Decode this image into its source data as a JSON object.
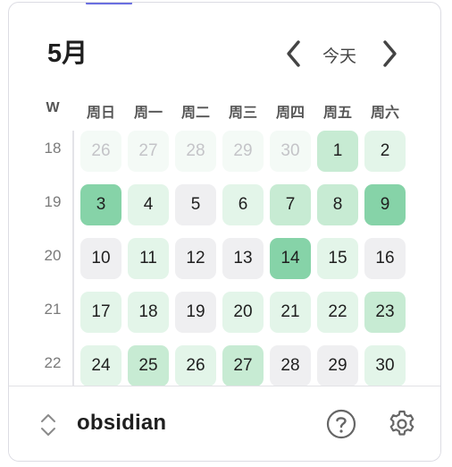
{
  "header": {
    "month_title": "5月",
    "today_label": "今天"
  },
  "weekday_header": {
    "week_col": "W",
    "days": [
      "周日",
      "周一",
      "周二",
      "周三",
      "周四",
      "周五",
      "周六"
    ]
  },
  "weeks": [
    {
      "week": "18",
      "days": [
        {
          "d": "26",
          "lvl": "out"
        },
        {
          "d": "27",
          "lvl": "out"
        },
        {
          "d": "28",
          "lvl": "out"
        },
        {
          "d": "29",
          "lvl": "out"
        },
        {
          "d": "30",
          "lvl": "out"
        },
        {
          "d": "1",
          "lvl": "2"
        },
        {
          "d": "2",
          "lvl": "1"
        }
      ]
    },
    {
      "week": "19",
      "days": [
        {
          "d": "3",
          "lvl": "3"
        },
        {
          "d": "4",
          "lvl": "1"
        },
        {
          "d": "5",
          "lvl": "0"
        },
        {
          "d": "6",
          "lvl": "1"
        },
        {
          "d": "7",
          "lvl": "2"
        },
        {
          "d": "8",
          "lvl": "2"
        },
        {
          "d": "9",
          "lvl": "3"
        }
      ]
    },
    {
      "week": "20",
      "days": [
        {
          "d": "10",
          "lvl": "0"
        },
        {
          "d": "11",
          "lvl": "1"
        },
        {
          "d": "12",
          "lvl": "0"
        },
        {
          "d": "13",
          "lvl": "0"
        },
        {
          "d": "14",
          "lvl": "3"
        },
        {
          "d": "15",
          "lvl": "1"
        },
        {
          "d": "16",
          "lvl": "0"
        }
      ]
    },
    {
      "week": "21",
      "days": [
        {
          "d": "17",
          "lvl": "1"
        },
        {
          "d": "18",
          "lvl": "1"
        },
        {
          "d": "19",
          "lvl": "0"
        },
        {
          "d": "20",
          "lvl": "1"
        },
        {
          "d": "21",
          "lvl": "1"
        },
        {
          "d": "22",
          "lvl": "1"
        },
        {
          "d": "23",
          "lvl": "2"
        }
      ]
    },
    {
      "week": "22",
      "days": [
        {
          "d": "24",
          "lvl": "1"
        },
        {
          "d": "25",
          "lvl": "2"
        },
        {
          "d": "26",
          "lvl": "1"
        },
        {
          "d": "27",
          "lvl": "2"
        },
        {
          "d": "28",
          "lvl": "0"
        },
        {
          "d": "29",
          "lvl": "0"
        },
        {
          "d": "30",
          "lvl": "1"
        }
      ]
    }
  ],
  "level_colors": {
    "out": "#f4faf6",
    "0": "#efeff1",
    "1": "#e3f5e9",
    "2": "#c7ebd3",
    "3": "#86d3a8"
  },
  "footer": {
    "vault_name": "obsidian"
  },
  "icons": {
    "prev": "chevron-left-icon",
    "next": "chevron-right-icon",
    "vault_switch": "chevron-updown-icon",
    "help": "help-circle-icon",
    "settings": "gear-icon"
  }
}
